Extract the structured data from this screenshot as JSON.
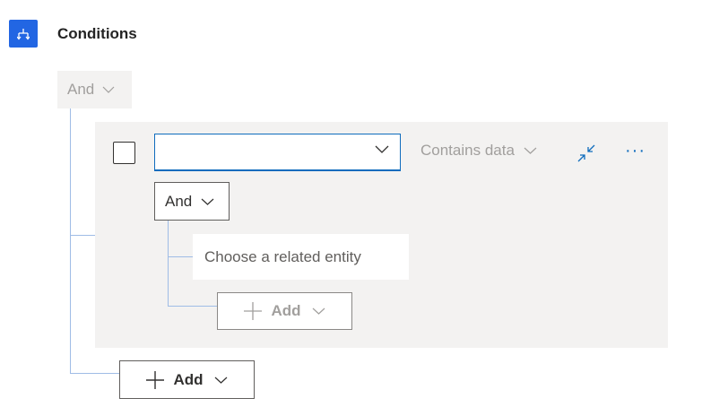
{
  "header": {
    "title": "Conditions",
    "icon": "hierarchy-icon",
    "icon_color": "#2266e3"
  },
  "outer_group": {
    "operator": "And",
    "add_label": "Add"
  },
  "row": {
    "field_value": "",
    "operator_label": "Contains data",
    "collapse_icon": "collapse-icon",
    "more_label": "···"
  },
  "inner_group": {
    "operator": "And",
    "related_entity_placeholder": "Choose a related entity",
    "add_label": "Add"
  },
  "colors": {
    "accent": "#0f6cbd",
    "tree_line": "#9fbce6",
    "group_bg": "#f3f2f1"
  }
}
